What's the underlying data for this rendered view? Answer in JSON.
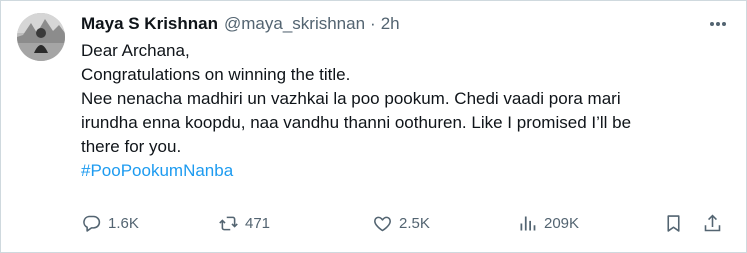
{
  "tweet": {
    "author_name": "Maya S Krishnan",
    "handle": "@maya_skrishnan",
    "separator": "·",
    "time": "2h",
    "lines": [
      "Dear Archana,",
      "Congratulations on winning the title.",
      "Nee nenacha madhiri un vazhkai la poo pookum. Chedi vaadi pora mari",
      "irundha enna koopdu, naa vandhu thanni oothuren. Like I promised I’ll be",
      "there for you."
    ],
    "hashtag": "#PooPookumNanba"
  },
  "actions": {
    "replies": "1.6K",
    "reposts": "471",
    "likes": "2.5K",
    "views": "209K"
  },
  "icons": {
    "more": "more-icon",
    "reply": "reply-icon",
    "repost": "repost-icon",
    "like": "like-icon",
    "views": "views-icon",
    "bookmark": "bookmark-icon",
    "share": "share-icon"
  },
  "colors": {
    "text": "#0f1419",
    "secondary": "#536471",
    "link": "#1d9bf0",
    "border": "#cfd9de"
  }
}
